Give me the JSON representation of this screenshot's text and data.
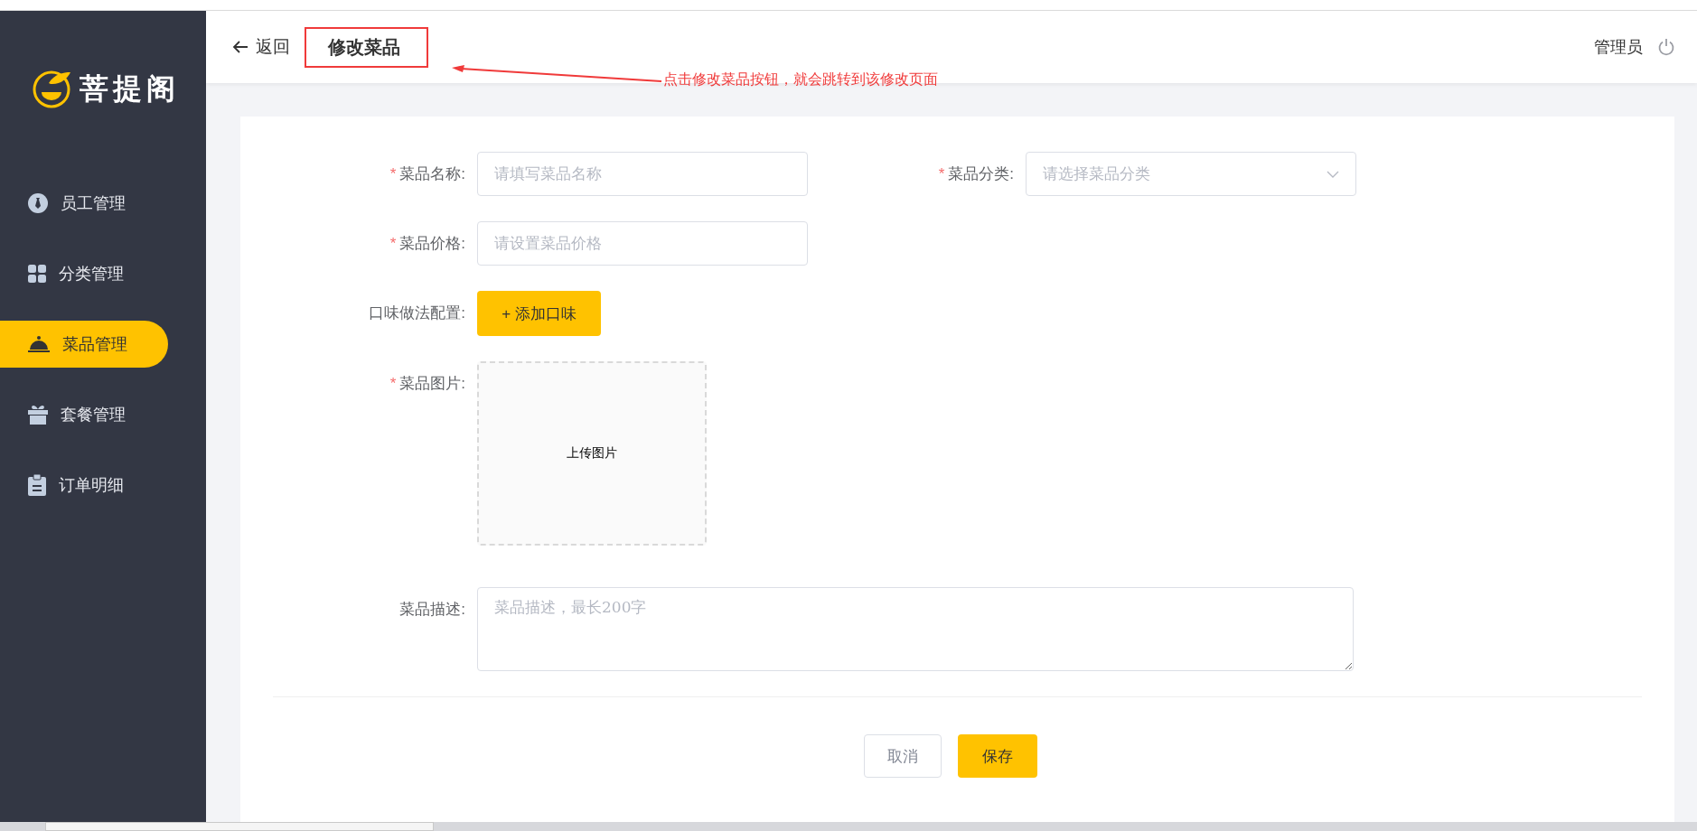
{
  "sidebar": {
    "logo": "菩提阁",
    "items": [
      {
        "label": "员工管理",
        "selected": false
      },
      {
        "label": "分类管理",
        "selected": false
      },
      {
        "label": "菜品管理",
        "selected": true
      },
      {
        "label": "套餐管理",
        "selected": false
      },
      {
        "label": "订单明细",
        "selected": false
      }
    ]
  },
  "header": {
    "back": "返回",
    "title": "修改菜品",
    "user": "管理员"
  },
  "annotation": {
    "text": "点击修改菜品按钮，就会跳转到该修改页面"
  },
  "form": {
    "rows": [
      [
        {
          "kind": "input",
          "marker": "*",
          "label": "菜品名称:",
          "placeholder": "请填写菜品名称"
        },
        {
          "kind": "select",
          "marker": "*",
          "label": "菜品分类:",
          "placeholder": "请选择菜品分类"
        }
      ],
      [
        {
          "kind": "input",
          "marker": "*",
          "label": "菜品价格:",
          "placeholder": "请设置菜品价格"
        }
      ],
      [
        {
          "kind": "button",
          "label": "口味做法配置:",
          "button": "+ 添加口味"
        }
      ],
      [
        {
          "kind": "upload",
          "marker": "*",
          "label": "菜品图片:",
          "text": "上传图片"
        }
      ],
      [
        {
          "kind": "textarea",
          "label": "菜品描述:",
          "placeholder": "菜品描述，最长200字"
        }
      ]
    ]
  },
  "actions": [
    {
      "label": "取消",
      "kind": "secondary"
    },
    {
      "label": "保存",
      "kind": "primary"
    }
  ]
}
